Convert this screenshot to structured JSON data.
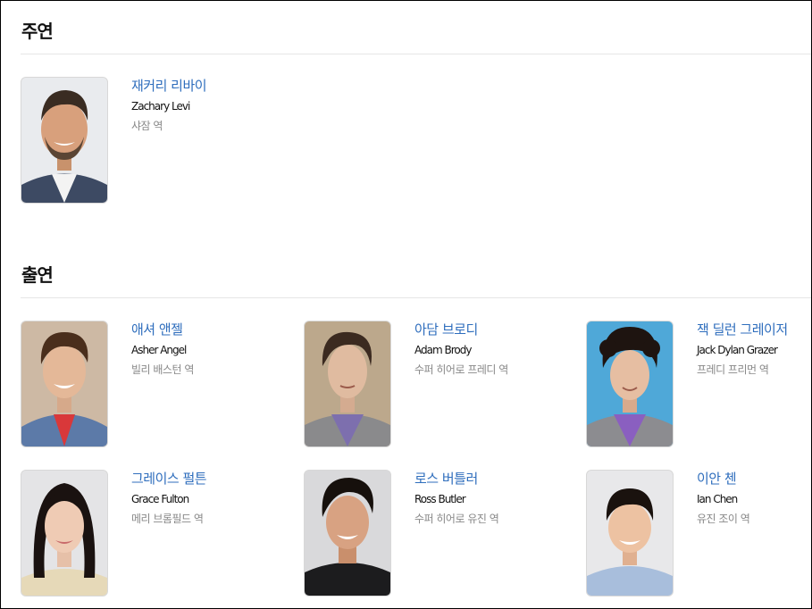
{
  "sections": {
    "lead": {
      "title": "주연",
      "cast": [
        {
          "name_ko": "재커리 리바이",
          "name_en": "Zachary Levi",
          "role": "샤잠 역"
        }
      ]
    },
    "supporting": {
      "title": "출연",
      "cast": [
        {
          "name_ko": "애셔 앤젤",
          "name_en": "Asher Angel",
          "role": "빌리 배스턴 역"
        },
        {
          "name_ko": "아담 브로디",
          "name_en": "Adam Brody",
          "role": "수퍼 히어로 프레디 역"
        },
        {
          "name_ko": "잭 딜런 그레이저",
          "name_en": "Jack Dylan Grazer",
          "role": "프레디 프리먼 역"
        },
        {
          "name_ko": "그레이스 펄튼",
          "name_en": "Grace Fulton",
          "role": "메리 브롬필드 역"
        },
        {
          "name_ko": "로스 버틀러",
          "name_en": "Ross Butler",
          "role": "수퍼 히어로 유진 역"
        },
        {
          "name_ko": "이안 첸",
          "name_en": "Ian Chen",
          "role": "유진 조이 역"
        }
      ]
    }
  },
  "colors": {
    "link": "#2f6ebd",
    "role_text": "#888888",
    "divider": "#e6e6e6"
  },
  "photo_icons": [
    "actor-photo-zachary-levi",
    "actor-photo-asher-angel",
    "actor-photo-adam-brody",
    "actor-photo-jack-dylan-grazer",
    "actor-photo-grace-fulton",
    "actor-photo-ross-butler",
    "actor-photo-ian-chen"
  ]
}
